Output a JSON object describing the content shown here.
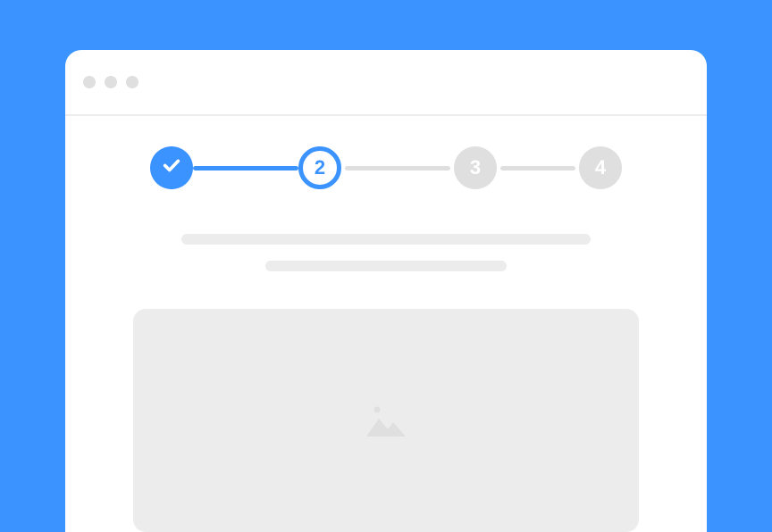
{
  "colors": {
    "accent": "#3B93FF",
    "muted": "#DFDFDF",
    "placeholder": "#ECECEC",
    "background": "#FFFFFF"
  },
  "stepper": {
    "steps": [
      {
        "label": "",
        "state": "completed"
      },
      {
        "label": "2",
        "state": "current"
      },
      {
        "label": "3",
        "state": "upcoming"
      },
      {
        "label": "4",
        "state": "upcoming"
      }
    ]
  }
}
